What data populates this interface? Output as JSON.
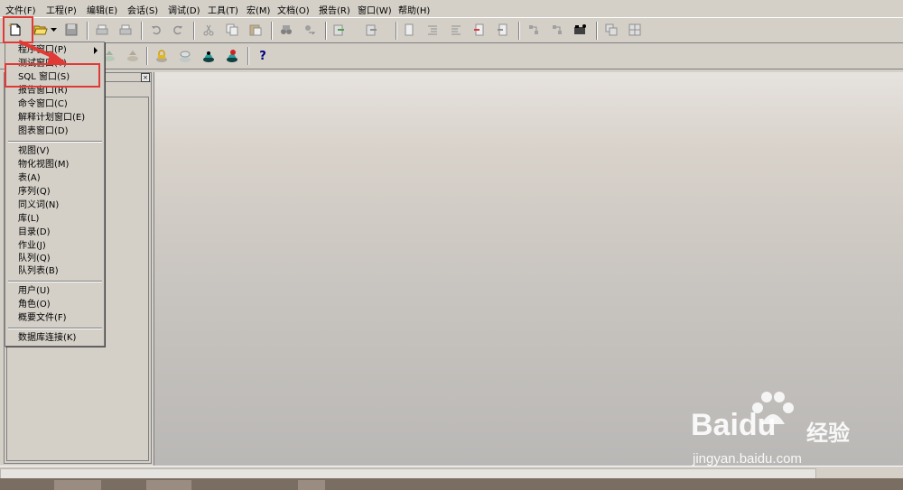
{
  "menubar": {
    "items": [
      "文件(F)",
      "工程(P)",
      "编辑(E)",
      "会话(S)",
      "调试(D)",
      "工具(T)",
      "宏(M)",
      "文档(O)",
      "报告(R)",
      "窗口(W)",
      "帮助(H)"
    ]
  },
  "toolbar": {
    "icons": [
      "new-icon",
      "open-icon",
      "dropdown-arrow-icon",
      "save-icon",
      "print-icon",
      "print-preview-icon",
      "undo-icon",
      "redo-icon",
      "cut-icon",
      "copy-icon",
      "paste-icon",
      "find-icon",
      "replace-icon",
      "help-icon"
    ]
  },
  "new_menu": {
    "groups": [
      [
        "程序窗口(P)",
        "测试窗口(T)",
        "SQL 窗口(S)",
        "报告窗口(R)",
        "命令窗口(C)",
        "解释计划窗口(E)",
        "图表窗口(D)"
      ],
      [
        "视图(V)",
        "物化视图(M)",
        "表(A)",
        "序列(Q)",
        "同义词(N)",
        "库(L)",
        "目录(D)",
        "作业(J)",
        "队列(Q)",
        "队列表(B)"
      ],
      [
        "用户(U)",
        "角色(O)",
        "概要文件(F)"
      ],
      [
        "数据库连接(K)"
      ]
    ]
  },
  "left_panel": {
    "close_label": "×"
  },
  "help_symbol": "?",
  "watermark": {
    "brand": "Baidu",
    "cn": "经验",
    "url": "jingyan.baidu.com"
  },
  "colors": {
    "highlight": "#e03a36",
    "brand_blue": "#2932e1"
  }
}
